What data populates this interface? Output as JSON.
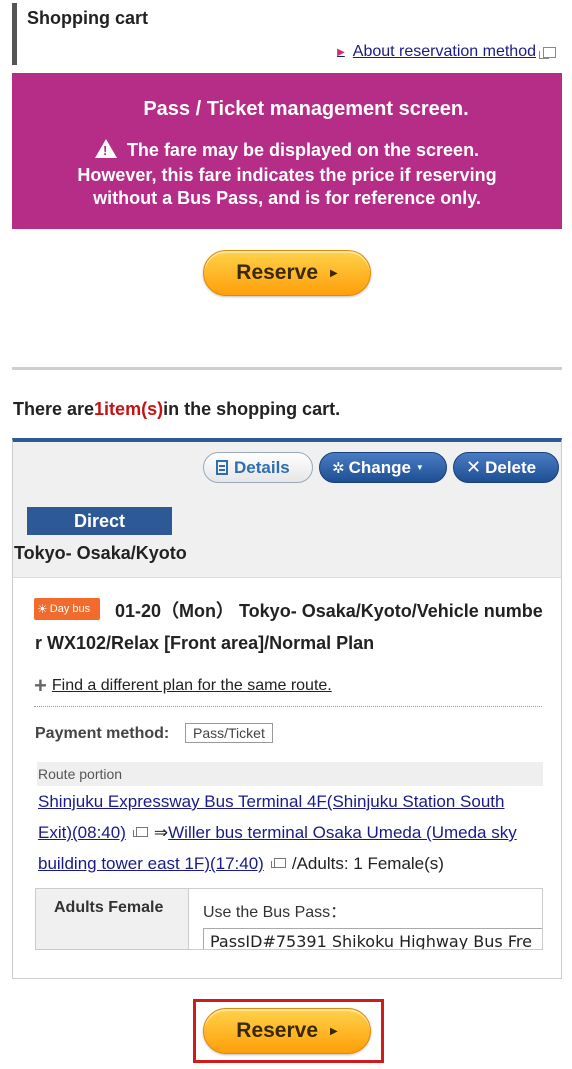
{
  "header": {
    "title": "Shopping cart",
    "about_link": "About reservation method"
  },
  "notice": {
    "title": "Pass / Ticket management screen.",
    "line1": "The fare may be displayed on the screen.",
    "line2": "However, this fare indicates the price if reserving",
    "line3": "without a Bus Pass, and is for reference only."
  },
  "reserve_label": "Reserve",
  "cart": {
    "summary_prefix": "There are",
    "summary_count": "1item(s)",
    "summary_suffix": "in the shopping cart.",
    "buttons": {
      "details": "Details",
      "change": "Change",
      "delete": "Delete"
    },
    "direct_tag": "Direct",
    "route_title": "Tokyo- Osaka/Kyoto",
    "item": {
      "badge": "Day bus",
      "description": "01-20（Mon） Tokyo- Osaka/Kyoto/Vehicle number WX102/Relax [Front area]/Normal Plan",
      "find_link": "Find a different plan for the same route.",
      "payment_label": "Payment method:",
      "payment_value": "Pass/Ticket",
      "route_portion_label": "Route portion",
      "departure": "Shinjuku Expressway Bus Terminal 4F(Shinjuku Station South Exit)(08:40)",
      "arrow": "⇒",
      "arrival": "Willer bus terminal Osaka Umeda (Umeda sky building tower east 1F)(17:40)",
      "passengers": "/Adults: 1 Female(s)",
      "pass_header": "Adults Female",
      "pass_label": "Use the Bus Pass：",
      "pass_value": "PassID#75391 Shikoku Highway Bus Fre"
    }
  },
  "colors": {
    "notice_bg": "#b52d86",
    "primary_blue": "#2d5a96",
    "reserve_orange": "#ffb020",
    "count_red": "#c41313",
    "highlight_red": "#d11a1a"
  }
}
